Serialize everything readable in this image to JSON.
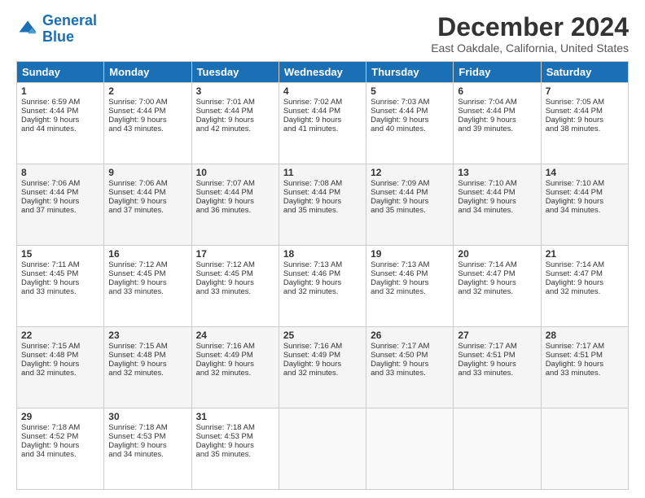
{
  "logo": {
    "line1": "General",
    "line2": "Blue"
  },
  "title": "December 2024",
  "subtitle": "East Oakdale, California, United States",
  "headers": [
    "Sunday",
    "Monday",
    "Tuesday",
    "Wednesday",
    "Thursday",
    "Friday",
    "Saturday"
  ],
  "weeks": [
    [
      {
        "day": "1",
        "lines": [
          "Sunrise: 6:59 AM",
          "Sunset: 4:44 PM",
          "Daylight: 9 hours",
          "and 44 minutes."
        ]
      },
      {
        "day": "2",
        "lines": [
          "Sunrise: 7:00 AM",
          "Sunset: 4:44 PM",
          "Daylight: 9 hours",
          "and 43 minutes."
        ]
      },
      {
        "day": "3",
        "lines": [
          "Sunrise: 7:01 AM",
          "Sunset: 4:44 PM",
          "Daylight: 9 hours",
          "and 42 minutes."
        ]
      },
      {
        "day": "4",
        "lines": [
          "Sunrise: 7:02 AM",
          "Sunset: 4:44 PM",
          "Daylight: 9 hours",
          "and 41 minutes."
        ]
      },
      {
        "day": "5",
        "lines": [
          "Sunrise: 7:03 AM",
          "Sunset: 4:44 PM",
          "Daylight: 9 hours",
          "and 40 minutes."
        ]
      },
      {
        "day": "6",
        "lines": [
          "Sunrise: 7:04 AM",
          "Sunset: 4:44 PM",
          "Daylight: 9 hours",
          "and 39 minutes."
        ]
      },
      {
        "day": "7",
        "lines": [
          "Sunrise: 7:05 AM",
          "Sunset: 4:44 PM",
          "Daylight: 9 hours",
          "and 38 minutes."
        ]
      }
    ],
    [
      {
        "day": "8",
        "lines": [
          "Sunrise: 7:06 AM",
          "Sunset: 4:44 PM",
          "Daylight: 9 hours",
          "and 37 minutes."
        ]
      },
      {
        "day": "9",
        "lines": [
          "Sunrise: 7:06 AM",
          "Sunset: 4:44 PM",
          "Daylight: 9 hours",
          "and 37 minutes."
        ]
      },
      {
        "day": "10",
        "lines": [
          "Sunrise: 7:07 AM",
          "Sunset: 4:44 PM",
          "Daylight: 9 hours",
          "and 36 minutes."
        ]
      },
      {
        "day": "11",
        "lines": [
          "Sunrise: 7:08 AM",
          "Sunset: 4:44 PM",
          "Daylight: 9 hours",
          "and 35 minutes."
        ]
      },
      {
        "day": "12",
        "lines": [
          "Sunrise: 7:09 AM",
          "Sunset: 4:44 PM",
          "Daylight: 9 hours",
          "and 35 minutes."
        ]
      },
      {
        "day": "13",
        "lines": [
          "Sunrise: 7:10 AM",
          "Sunset: 4:44 PM",
          "Daylight: 9 hours",
          "and 34 minutes."
        ]
      },
      {
        "day": "14",
        "lines": [
          "Sunrise: 7:10 AM",
          "Sunset: 4:44 PM",
          "Daylight: 9 hours",
          "and 34 minutes."
        ]
      }
    ],
    [
      {
        "day": "15",
        "lines": [
          "Sunrise: 7:11 AM",
          "Sunset: 4:45 PM",
          "Daylight: 9 hours",
          "and 33 minutes."
        ]
      },
      {
        "day": "16",
        "lines": [
          "Sunrise: 7:12 AM",
          "Sunset: 4:45 PM",
          "Daylight: 9 hours",
          "and 33 minutes."
        ]
      },
      {
        "day": "17",
        "lines": [
          "Sunrise: 7:12 AM",
          "Sunset: 4:45 PM",
          "Daylight: 9 hours",
          "and 33 minutes."
        ]
      },
      {
        "day": "18",
        "lines": [
          "Sunrise: 7:13 AM",
          "Sunset: 4:46 PM",
          "Daylight: 9 hours",
          "and 32 minutes."
        ]
      },
      {
        "day": "19",
        "lines": [
          "Sunrise: 7:13 AM",
          "Sunset: 4:46 PM",
          "Daylight: 9 hours",
          "and 32 minutes."
        ]
      },
      {
        "day": "20",
        "lines": [
          "Sunrise: 7:14 AM",
          "Sunset: 4:47 PM",
          "Daylight: 9 hours",
          "and 32 minutes."
        ]
      },
      {
        "day": "21",
        "lines": [
          "Sunrise: 7:14 AM",
          "Sunset: 4:47 PM",
          "Daylight: 9 hours",
          "and 32 minutes."
        ]
      }
    ],
    [
      {
        "day": "22",
        "lines": [
          "Sunrise: 7:15 AM",
          "Sunset: 4:48 PM",
          "Daylight: 9 hours",
          "and 32 minutes."
        ]
      },
      {
        "day": "23",
        "lines": [
          "Sunrise: 7:15 AM",
          "Sunset: 4:48 PM",
          "Daylight: 9 hours",
          "and 32 minutes."
        ]
      },
      {
        "day": "24",
        "lines": [
          "Sunrise: 7:16 AM",
          "Sunset: 4:49 PM",
          "Daylight: 9 hours",
          "and 32 minutes."
        ]
      },
      {
        "day": "25",
        "lines": [
          "Sunrise: 7:16 AM",
          "Sunset: 4:49 PM",
          "Daylight: 9 hours",
          "and 32 minutes."
        ]
      },
      {
        "day": "26",
        "lines": [
          "Sunrise: 7:17 AM",
          "Sunset: 4:50 PM",
          "Daylight: 9 hours",
          "and 33 minutes."
        ]
      },
      {
        "day": "27",
        "lines": [
          "Sunrise: 7:17 AM",
          "Sunset: 4:51 PM",
          "Daylight: 9 hours",
          "and 33 minutes."
        ]
      },
      {
        "day": "28",
        "lines": [
          "Sunrise: 7:17 AM",
          "Sunset: 4:51 PM",
          "Daylight: 9 hours",
          "and 33 minutes."
        ]
      }
    ],
    [
      {
        "day": "29",
        "lines": [
          "Sunrise: 7:18 AM",
          "Sunset: 4:52 PM",
          "Daylight: 9 hours",
          "and 34 minutes."
        ]
      },
      {
        "day": "30",
        "lines": [
          "Sunrise: 7:18 AM",
          "Sunset: 4:53 PM",
          "Daylight: 9 hours",
          "and 34 minutes."
        ]
      },
      {
        "day": "31",
        "lines": [
          "Sunrise: 7:18 AM",
          "Sunset: 4:53 PM",
          "Daylight: 9 hours",
          "and 35 minutes."
        ]
      },
      null,
      null,
      null,
      null
    ]
  ]
}
